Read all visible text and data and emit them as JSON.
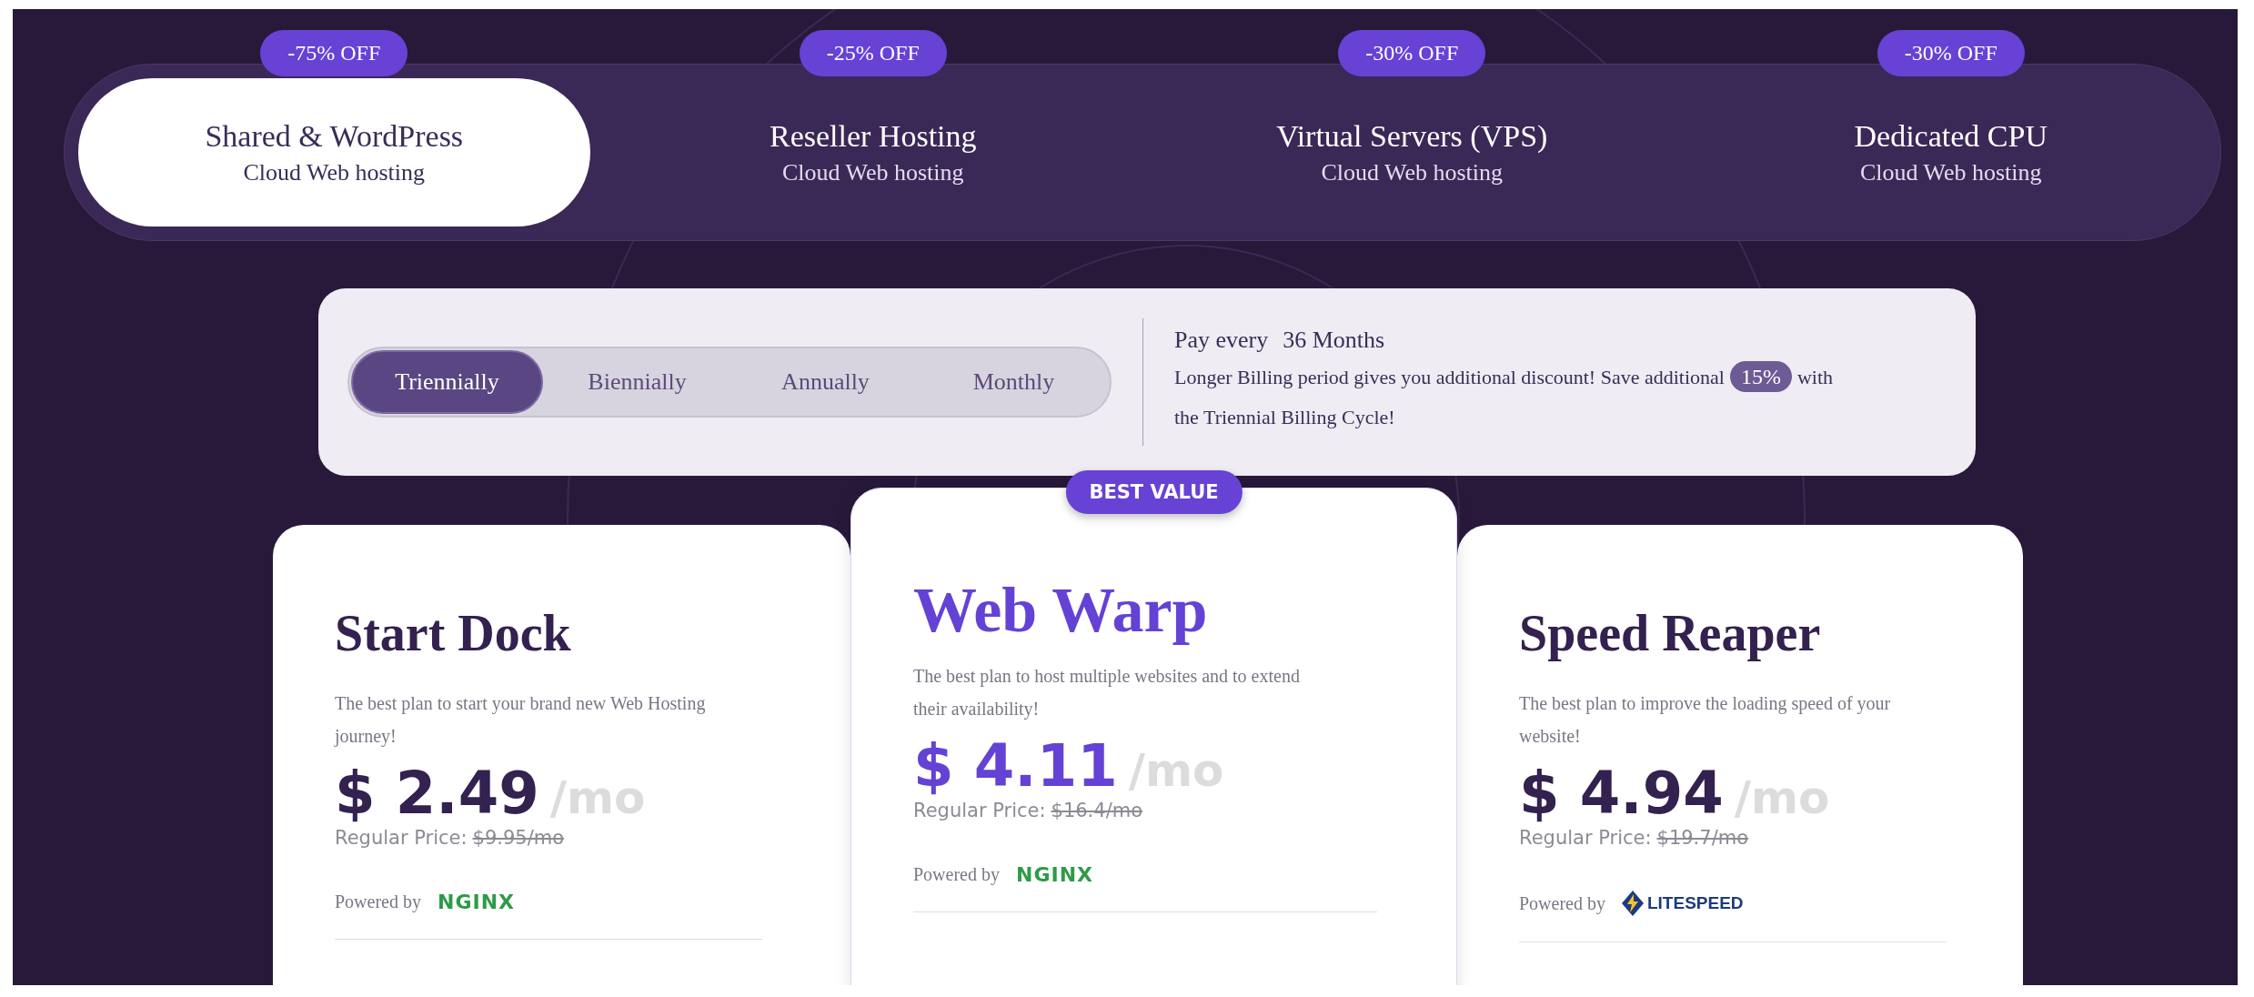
{
  "categories": [
    {
      "badge": "-75% OFF",
      "title": "Shared & WordPress",
      "subtitle": "Cloud Web hosting",
      "selected": true
    },
    {
      "badge": "-25% OFF",
      "title": "Reseller Hosting",
      "subtitle": "Cloud Web hosting",
      "selected": false
    },
    {
      "badge": "-30% OFF",
      "title": "Virtual Servers (VPS)",
      "subtitle": "Cloud Web hosting",
      "selected": false
    },
    {
      "badge": "-30% OFF",
      "title": "Dedicated CPU",
      "subtitle": "Cloud Web hosting",
      "selected": false
    }
  ],
  "billing": {
    "periods": [
      {
        "label": "Triennially",
        "selected": true
      },
      {
        "label": "Biennially",
        "selected": false
      },
      {
        "label": "Annually",
        "selected": false
      },
      {
        "label": "Monthly",
        "selected": false
      }
    ],
    "pay_every_label": "Pay every",
    "pay_every_value": "36 Months",
    "note": "Longer Billing period gives you additional discount! Save additional",
    "discount": "15%",
    "note_end": "with",
    "note_line2": "the  Triennial Billing Cycle!"
  },
  "plans": [
    {
      "name": "Start Dock",
      "featured": false,
      "description": "The best plan to start your brand new Web Hosting journey!",
      "price": "$ 2.49",
      "period": "/mo",
      "regular_label": "Regular Price:",
      "regular_price": "$9.95/mo",
      "powered_by": "Powered by",
      "server": {
        "kind": "nginx",
        "logo": "NGINX"
      }
    },
    {
      "name": "Web Warp",
      "featured": true,
      "ribbon": "BEST VALUE",
      "description": "The best plan to host multiple websites and to extend their availability!",
      "price": "$ 4.11",
      "period": "/mo",
      "regular_label": "Regular Price:",
      "regular_price": "$16.4/mo",
      "powered_by": "Powered by",
      "server": {
        "kind": "nginx",
        "logo": "NGINX"
      }
    },
    {
      "name": "Speed Reaper",
      "featured": false,
      "description": "The best plan to improve the loading speed of your website!",
      "price": "$ 4.94",
      "period": "/mo",
      "regular_label": "Regular Price:",
      "regular_price": "$19.7/mo",
      "powered_by": "Powered by",
      "server": {
        "kind": "litespeed",
        "logo": "LITESPEED"
      }
    }
  ]
}
